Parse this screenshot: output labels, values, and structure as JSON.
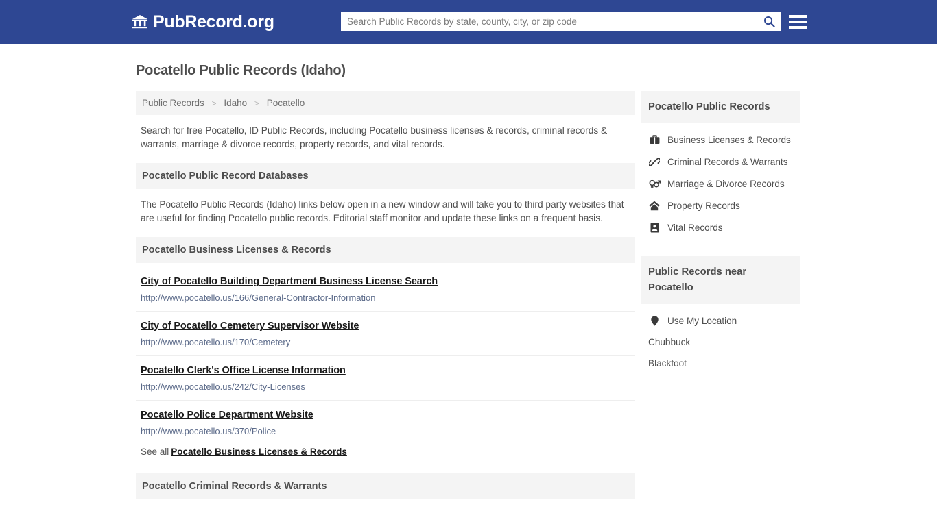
{
  "header": {
    "logo_text": "PubRecord.org",
    "logo_icon": "bank-building-icon",
    "search_placeholder": "Search Public Records by state, county, city, or zip code",
    "search_value": "",
    "search_icon": "search-icon",
    "menu_icon": "hamburger-menu-icon",
    "background_color": "#2e4793"
  },
  "page": {
    "title": "Pocatello Public Records (Idaho)"
  },
  "breadcrumb": {
    "items": [
      {
        "label": "Public Records"
      },
      {
        "label": "Idaho"
      },
      {
        "label": "Pocatello"
      }
    ],
    "separator": ">"
  },
  "intro": {
    "text": "Search for free Pocatello, ID Public Records, including Pocatello business licenses & records, criminal records & warrants, marriage & divorce records, property records, and vital records."
  },
  "databases": {
    "heading": "Pocatello Public Record Databases",
    "text": "The Pocatello Public Records (Idaho) links below open in a new window and will take you to third party websites that are useful for finding Pocatello public records. Editorial staff monitor and update these links on a frequent basis."
  },
  "business_section": {
    "heading": "Pocatello Business Licenses & Records",
    "records": [
      {
        "title": "City of Pocatello Building Department Business License Search",
        "url": "http://www.pocatello.us/166/General-Contractor-Information"
      },
      {
        "title": "City of Pocatello Cemetery Supervisor Website",
        "url": "http://www.pocatello.us/170/Cemetery"
      },
      {
        "title": "Pocatello Clerk's Office License Information",
        "url": "http://www.pocatello.us/242/City-Licenses"
      },
      {
        "title": "Pocatello Police Department Website",
        "url": "http://www.pocatello.us/370/Police"
      }
    ],
    "see_all_prefix": "See all",
    "see_all_link": "Pocatello Business Licenses & Records"
  },
  "criminal_section": {
    "heading": "Pocatello Criminal Records & Warrants"
  },
  "sidebar": {
    "records_card": {
      "heading": "Pocatello Public Records",
      "items": [
        {
          "label": "Business Licenses & Records",
          "icon": "briefcase-icon"
        },
        {
          "label": "Criminal Records & Warrants",
          "icon": "chain-link-icon"
        },
        {
          "label": "Marriage & Divorce Records",
          "icon": "venus-mars-icon"
        },
        {
          "label": "Property Records",
          "icon": "home-icon"
        },
        {
          "label": "Vital Records",
          "icon": "id-card-icon"
        }
      ]
    },
    "nearby_card": {
      "heading": "Public Records near Pocatello",
      "items": [
        {
          "label": "Use My Location",
          "icon": "map-marker-icon"
        },
        {
          "label": "Chubbuck",
          "icon": ""
        },
        {
          "label": "Blackfoot",
          "icon": ""
        }
      ]
    }
  }
}
